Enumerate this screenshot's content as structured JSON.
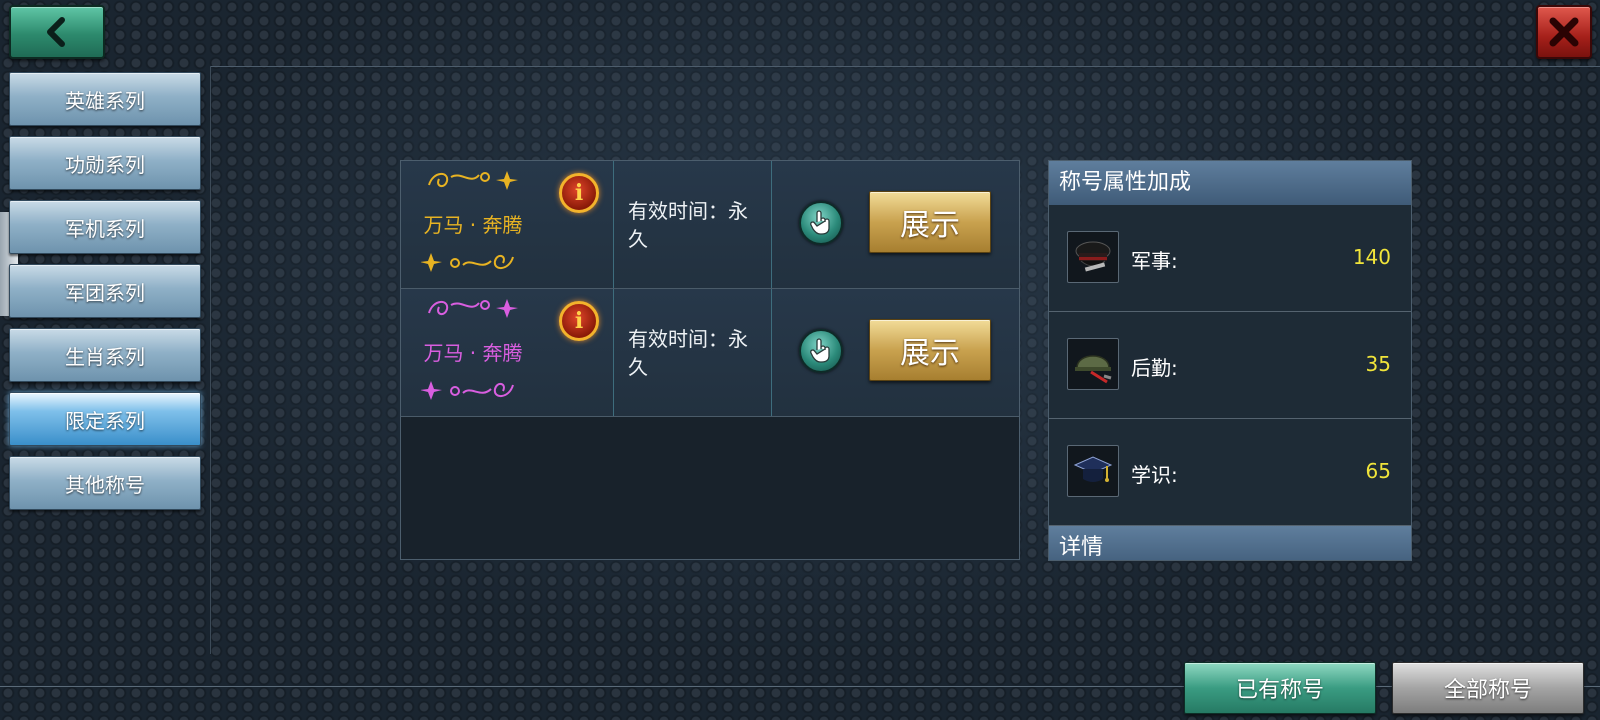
{
  "colors": {
    "gold_title": "#e8b322",
    "pink_title": "#d95ee0",
    "attr_value": "#f0e43a",
    "accent_green": "#3a9c82",
    "close_red": "#a5201a"
  },
  "sidebar": {
    "items": [
      {
        "label": "英雄系列",
        "active": false
      },
      {
        "label": "功勋系列",
        "active": false
      },
      {
        "label": "军机系列",
        "active": false
      },
      {
        "label": "军团系列",
        "active": false
      },
      {
        "label": "生肖系列",
        "active": false
      },
      {
        "label": "限定系列",
        "active": true
      },
      {
        "label": "其他称号",
        "active": false
      }
    ]
  },
  "titles": [
    {
      "name": "万马 · 奔腾",
      "name_color": "gold",
      "validity": "有效时间：永久",
      "button": "展示",
      "info_icon": "info-icon",
      "action_icon": "hand-pointer-icon"
    },
    {
      "name": "万马 · 奔腾",
      "name_color": "pink",
      "validity": "有效时间：永久",
      "button": "展示",
      "info_icon": "info-icon",
      "action_icon": "hand-pointer-icon"
    }
  ],
  "attributes": {
    "header": "称号属性加成",
    "rows": [
      {
        "label": "军事:",
        "value": "140",
        "icon": "military-cap-icon"
      },
      {
        "label": "后勤:",
        "value": "35",
        "icon": "helmet-icon"
      },
      {
        "label": "学识:",
        "value": "65",
        "icon": "graduation-cap-icon"
      }
    ],
    "detail_header": "详情"
  },
  "bottom_tabs": {
    "owned": "已有称号",
    "all": "全部称号"
  },
  "icons": {
    "back": "chevron-left-icon",
    "close": "close-icon"
  }
}
